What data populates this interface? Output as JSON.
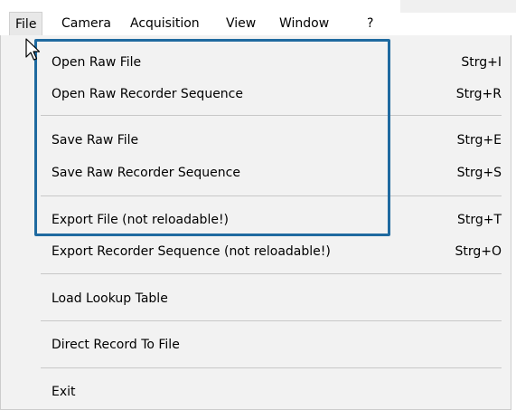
{
  "menubar": {
    "items": [
      {
        "label": "File"
      },
      {
        "label": "Camera"
      },
      {
        "label": "Acquisition"
      },
      {
        "label": "View"
      },
      {
        "label": "Window"
      },
      {
        "label": "?"
      }
    ]
  },
  "file_menu": {
    "items": [
      {
        "label": "Open Raw File",
        "shortcut": "Strg+I"
      },
      {
        "label": "Open Raw Recorder Sequence",
        "shortcut": "Strg+R"
      },
      {
        "label": "Save Raw File",
        "shortcut": "Strg+E"
      },
      {
        "label": "Save Raw Recorder Sequence",
        "shortcut": "Strg+S"
      },
      {
        "label": "Export File (not reloadable!)",
        "shortcut": "Strg+T"
      },
      {
        "label": "Export Recorder Sequence (not reloadable!)",
        "shortcut": "Strg+O"
      },
      {
        "label": "Load Lookup Table",
        "shortcut": ""
      },
      {
        "label": "Direct Record To File",
        "shortcut": ""
      },
      {
        "label": "Exit",
        "shortcut": ""
      }
    ]
  },
  "colors": {
    "highlight_border": "#1f6aa0",
    "menu_background": "#f2f2f2",
    "separator": "#c8c8c8"
  },
  "icons": {
    "cursor": "arrow-cursor-icon"
  }
}
